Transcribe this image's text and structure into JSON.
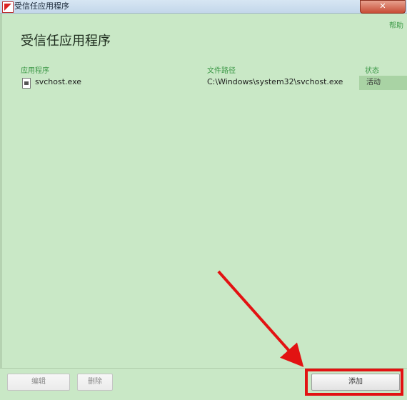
{
  "window": {
    "title": "受信任应用程序",
    "close_symbol": "✕"
  },
  "header": {
    "help_link": "帮助",
    "title": "受信任应用程序"
  },
  "table": {
    "columns": [
      "应用程序",
      "文件路径",
      "状态"
    ],
    "rows": [
      {
        "app": "svchost.exe",
        "path": "C:\\Windows\\system32\\svchost.exe",
        "status": "活动"
      }
    ]
  },
  "footer": {
    "edit_label": "编辑",
    "remove_label": "删除",
    "add_label": "添加"
  },
  "colors": {
    "background": "#c9e8c6",
    "accent_green": "#3c9847",
    "highlight_red": "#e21212"
  }
}
